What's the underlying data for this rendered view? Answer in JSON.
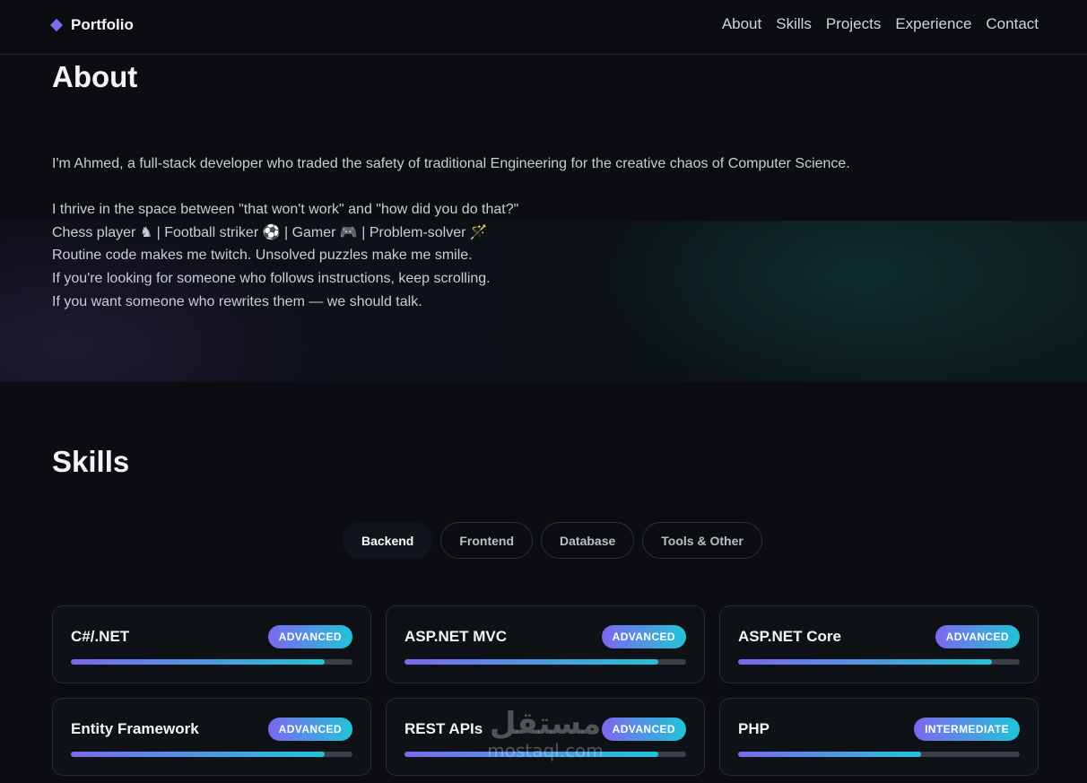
{
  "nav": {
    "brand": "Portfolio",
    "links": [
      "About",
      "Skills",
      "Projects",
      "Experience",
      "Contact"
    ]
  },
  "about": {
    "title": "About",
    "line1": "I'm Ahmed, a full-stack developer who traded the safety of traditional Engineering for the creative chaos of Computer Science.",
    "line2": "I thrive in the space between \"that won't work\" and \"how did you do that?\"",
    "interests": {
      "chess": "Chess player ♞",
      "sep": " | ",
      "football": "Football striker ⚽",
      "gamer": "Gamer 🎮",
      "solver": "Problem-solver 🪄"
    },
    "line4": "Routine code makes me twitch. Unsolved puzzles make me smile.",
    "line5": "If you're looking for someone who follows instructions, keep scrolling.",
    "line6": "If you want someone who rewrites them — we should talk."
  },
  "skills": {
    "title": "Skills",
    "tabs": [
      "Backend",
      "Frontend",
      "Database",
      "Tools & Other"
    ],
    "active_tab": "Backend",
    "items": [
      {
        "name": "C#/.NET",
        "level": "ADVANCED",
        "progress": 0.9
      },
      {
        "name": "ASP.NET MVC",
        "level": "ADVANCED",
        "progress": 0.9
      },
      {
        "name": "ASP.NET Core",
        "level": "ADVANCED",
        "progress": 0.9
      },
      {
        "name": "Entity Framework",
        "level": "ADVANCED",
        "progress": 0.9
      },
      {
        "name": "REST APIs",
        "level": "ADVANCED",
        "progress": 0.9
      },
      {
        "name": "PHP",
        "level": "INTERMEDIATE",
        "progress": 0.65
      }
    ]
  },
  "watermark": {
    "arabic": "مستقل",
    "latin": "mostaql.com"
  }
}
